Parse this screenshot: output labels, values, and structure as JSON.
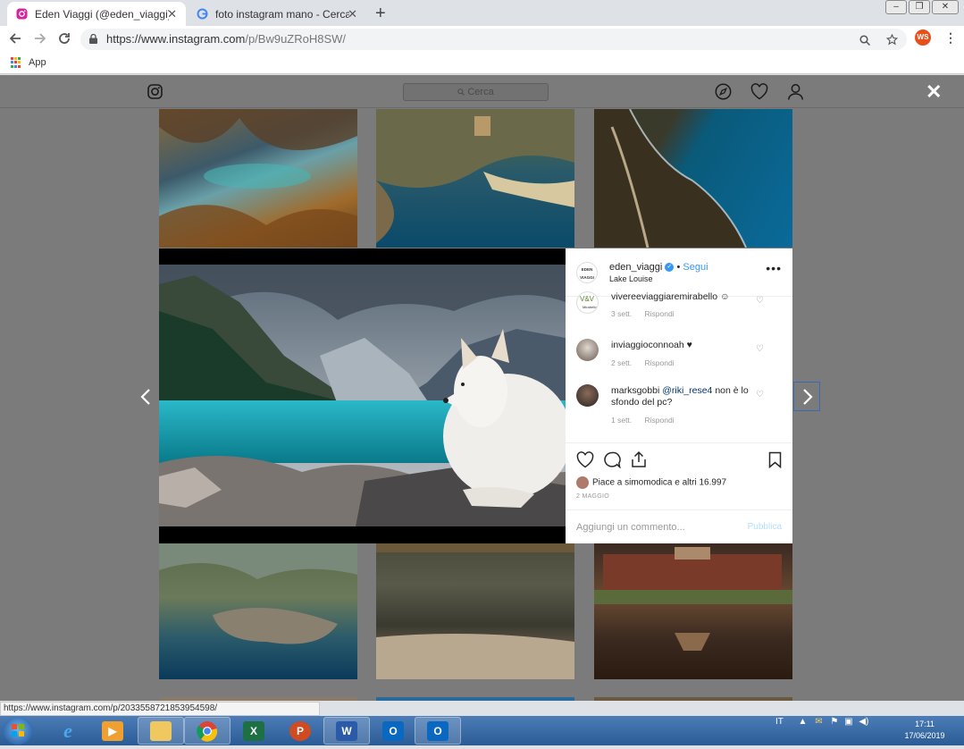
{
  "tabs": [
    {
      "title": "Eden Viaggi (@eden_viaggi) • Foto",
      "close": "✕"
    },
    {
      "title": "foto instagram mano - Cerca con Google",
      "close": "✕"
    }
  ],
  "new_tab": "+",
  "window_buttons": {
    "minimize": "–",
    "restore": "❐",
    "close": "✕"
  },
  "address": {
    "host": "https://www.instagram.com",
    "path": "/p/Bw9uZRoH8SW/"
  },
  "profile_initials": "WS",
  "bookmarks": {
    "apps_label": "App"
  },
  "instagram": {
    "search_placeholder": "Cerca",
    "post": {
      "username": "eden_viaggi",
      "follow": "Segui",
      "separator": "•",
      "location": "Lake Louise",
      "logo_text": "EDEN VIAGGI",
      "comments": [
        {
          "user": "vivereeviaggiaremirabello",
          "text": "☺",
          "time": "3 sett.",
          "reply": "Rispondi"
        },
        {
          "user": "inviaggioconnoah",
          "text": "♥",
          "time": "2 sett.",
          "reply": "Rispondi"
        },
        {
          "user": "marksgobbi",
          "mention": "@riki_rese4",
          "text": "non è lo sfondo del pc?",
          "time": "1 sett.",
          "reply": "Rispondi"
        }
      ],
      "likes_text": "Piace a simomodica e altri 16.997",
      "date": "2 MAGGIO",
      "comment_placeholder": "Aggiungi un commento...",
      "publish": "Pubblica"
    }
  },
  "status_url": "https://www.instagram.com/p/2033558721853954598/",
  "taskbar": {
    "tray_lang": "IT",
    "time": "17:11",
    "date": "17/06/2019"
  }
}
